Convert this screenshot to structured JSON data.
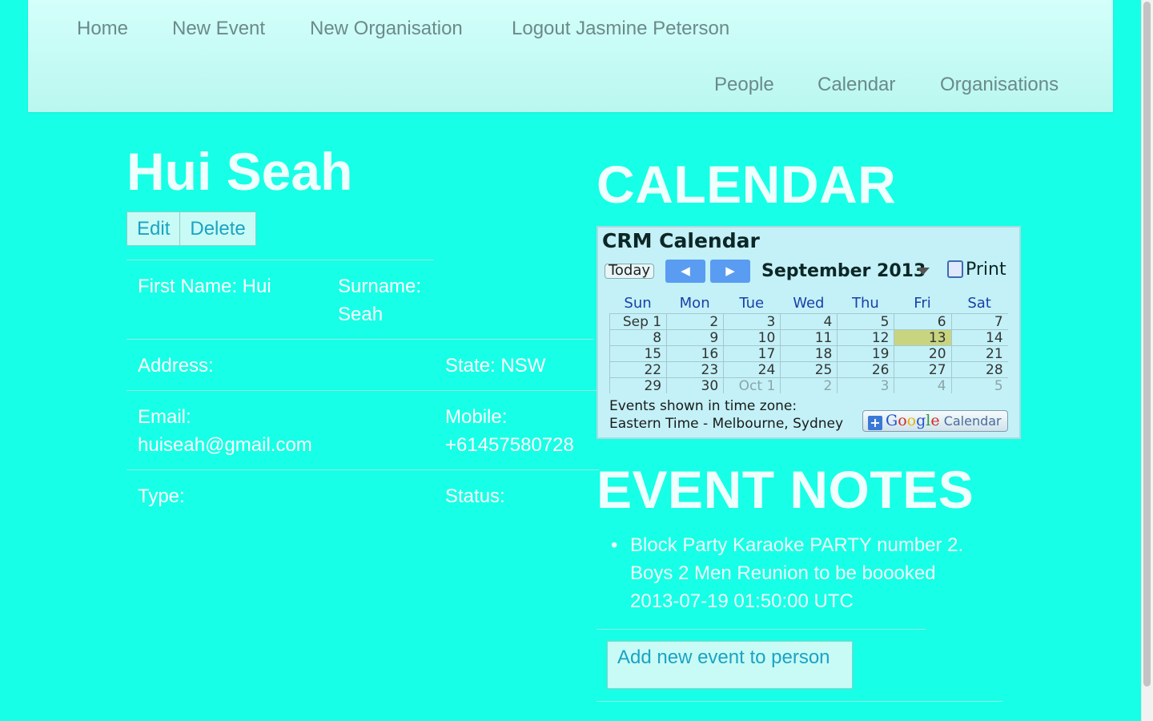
{
  "nav": {
    "home": "Home",
    "new_event": "New Event",
    "new_organisation": "New Organisation",
    "logout": "Logout Jasmine Peterson",
    "people": "People",
    "calendar": "Calendar",
    "organisations": "Organisations"
  },
  "person": {
    "name": "Hui Seah",
    "edit_label": "Edit",
    "delete_label": "Delete",
    "first_name": "First Name: Hui",
    "surname_label": "Surname:",
    "surname_value": "Seah",
    "address": "Address:",
    "state": "State: NSW",
    "email_label": "Email:",
    "email_value": "huiseah@gmail.com",
    "mobile_label": "Mobile:",
    "mobile_value": "+61457580728",
    "type": "Type:",
    "status": "Status:"
  },
  "calendar_section": {
    "heading": "CALENDAR",
    "widget": {
      "title": "CRM Calendar",
      "today_label": "Today",
      "month": "September 2013",
      "print_label": "Print",
      "days_of_week": [
        "Sun",
        "Mon",
        "Tue",
        "Wed",
        "Thu",
        "Fri",
        "Sat"
      ],
      "weeks": [
        [
          "Sep 1",
          "2",
          "3",
          "4",
          "5",
          "6",
          "7"
        ],
        [
          "8",
          "9",
          "10",
          "11",
          "12",
          "13",
          "14"
        ],
        [
          "15",
          "16",
          "17",
          "18",
          "19",
          "20",
          "21"
        ],
        [
          "22",
          "23",
          "24",
          "25",
          "26",
          "27",
          "28"
        ],
        [
          "29",
          "30",
          "Oct 1",
          "2",
          "3",
          "4",
          "5"
        ]
      ],
      "highlighted_day": "13",
      "timezone_note": "Events shown in time zone: Eastern Time - Melbourne, Sydney",
      "google_calendar_label": "Calendar",
      "google_logo_text": "Google"
    }
  },
  "event_notes": {
    "heading": "EVENT NOTES",
    "items": [
      "Block Party Karaoke PARTY number 2. Boys 2 Men Reunion to be boooked 2013-07-19 01:50:00 UTC"
    ],
    "add_button": "Add new event to person"
  },
  "colors": {
    "page_background": "#17ffe6",
    "nav_background": "#c9fcf6",
    "link_blue": "#1aa3c6",
    "today_highlight": "#c9d480"
  }
}
